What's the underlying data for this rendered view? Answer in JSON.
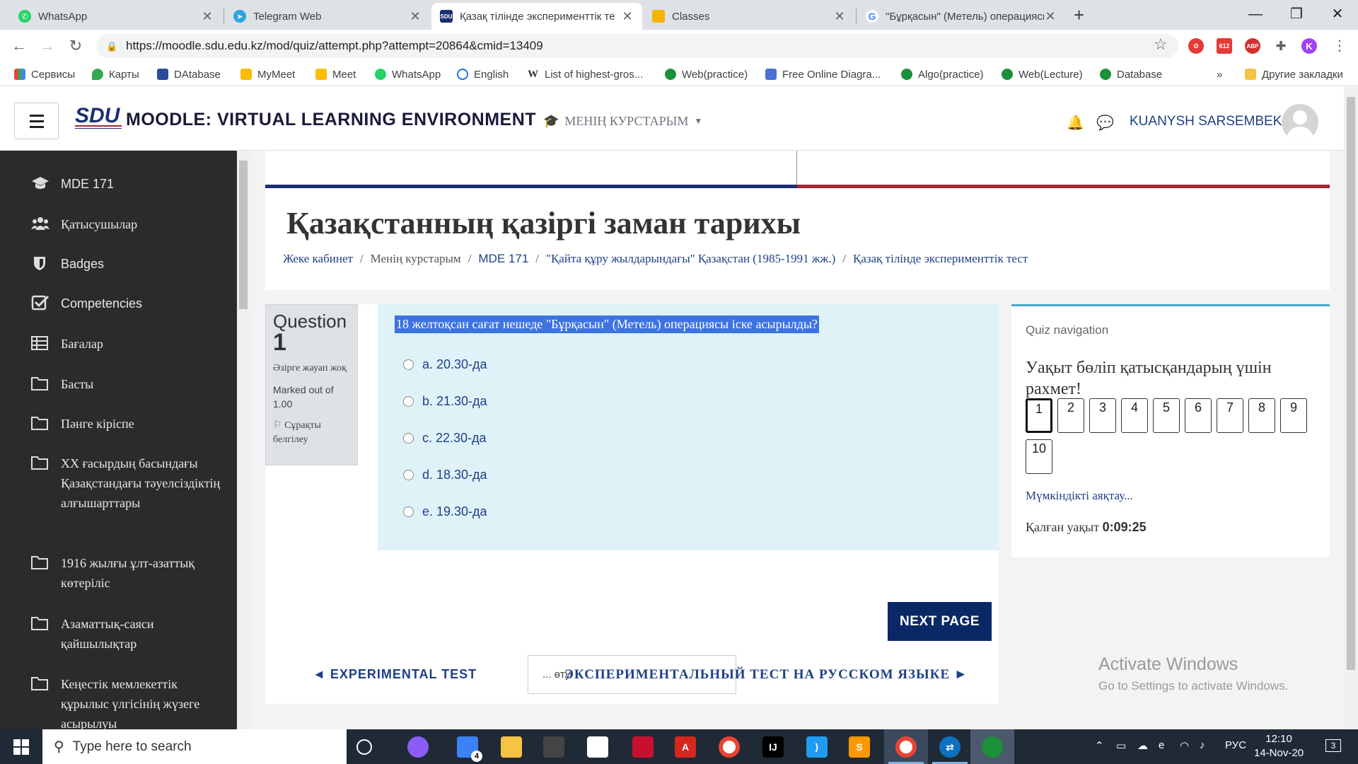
{
  "browser": {
    "tabs": [
      {
        "title": "WhatsApp",
        "color": "#25d366"
      },
      {
        "title": "Telegram Web",
        "color": "#2ca5e0"
      },
      {
        "title": "Қазақ тілінде эксперименттік те",
        "color": "#1c2f73"
      },
      {
        "title": "Classes",
        "color": "#f4b400"
      },
      {
        "title": "\"Бұрқасын\" (Метель) операциясы",
        "color": "#4285f4"
      }
    ],
    "url": "https://moodle.sdu.edu.kz/mod/quiz/attempt.php?attempt=20864&cmid=13409",
    "ext_badge": "612",
    "profile_letter": "K",
    "bookmarks": [
      {
        "label": "Сервисы",
        "color": "#e94235"
      },
      {
        "label": "Карты",
        "color": "#34a853"
      },
      {
        "label": "DAtabase",
        "color": "#2b4a9b"
      },
      {
        "label": "MyMeet",
        "color": "#fbbc04"
      },
      {
        "label": "Meet",
        "color": "#fbbc04"
      },
      {
        "label": "WhatsApp",
        "color": "#25d366"
      },
      {
        "label": "English",
        "color": "#1a73e8"
      },
      {
        "label": "List of highest-gros...",
        "color": "#333333"
      },
      {
        "label": "Web(practice)",
        "color": "#1b8f3a"
      },
      {
        "label": "Free Online Diagra...",
        "color": "#4a6fd6"
      },
      {
        "label": "Algo(practice)",
        "color": "#1b8f3a"
      },
      {
        "label": "Web(Lecture)",
        "color": "#1b8f3a"
      },
      {
        "label": "Database",
        "color": "#1b8f3a"
      }
    ],
    "more": "»",
    "other_bookmarks": "Другие закладки"
  },
  "header": {
    "site_name": "MOODLE: VIRTUAL LEARNING ENVIRONMENT",
    "logo_text": "SDU",
    "my_courses": "МЕНІҢ КУРСТАРЫМ",
    "user_name": "KUANYSH SARSEMBEK"
  },
  "sidebar": {
    "items": [
      {
        "label": "MDE 171",
        "icon": "graduation-cap-icon"
      },
      {
        "label": "Қатысушылар",
        "icon": "users-icon"
      },
      {
        "label": "Badges",
        "icon": "shield-icon"
      },
      {
        "label": "Competencies",
        "icon": "checkbox-icon"
      },
      {
        "label": "Бағалар",
        "icon": "table-icon"
      },
      {
        "label": "Басты",
        "icon": "folder-icon"
      },
      {
        "label": "Пәнге кіріспе",
        "icon": "folder-icon"
      },
      {
        "label": "ХХ ғасырдың басындағы Қазақстандағы тәуелсіздіктің алғышарттары",
        "icon": "folder-icon"
      },
      {
        "label": "1916 жылғы ұлт-азаттық көтеріліс",
        "icon": "folder-icon"
      },
      {
        "label": "Азаматтық-саяси қайшылықтар",
        "icon": "folder-icon"
      },
      {
        "label": "Кеңестік мемлекеттік құрылыс үлгісінің жүзеге асырылуы",
        "icon": "folder-icon"
      }
    ]
  },
  "page": {
    "title": "Қазақстанның қазіргі заман тарихы",
    "breadcrumb": [
      "Жеке кабинет",
      "Менің курстарым",
      "MDE 171",
      "\"Қайта құру жылдарындағы\" Қазақстан (1985-1991 жж.)",
      "Қазақ тілінде эксперименттік тест"
    ]
  },
  "question": {
    "label": "Question",
    "number": "1",
    "status": "Әзірге жауап жоқ",
    "marked": "Marked out of 1.00",
    "flag": "Сұрақты белгілеу",
    "text": "18 желтоқсан сағат нешеде \"Бұрқасын\" (Метель) операциясы іске асырылды?",
    "answers": [
      "a. 20.30-да",
      "b. 21.30-да",
      "c. 22.30-да",
      "d. 18.30-да",
      "e. 19.30-да"
    ]
  },
  "footer_nav": {
    "next_page": "NEXT PAGE",
    "prev_activity": "◄ EXPERIMENTAL TEST",
    "jump_to": "... өту",
    "next_activity": "ЭКСПЕРИМЕНТАЛЬНЫЙ ТЕСТ НА РУССКОМ ЯЗЫКЕ ►"
  },
  "quiz_nav": {
    "heading": "Quiz navigation",
    "thanks": "Уақыт бөліп қатысқандарың үшін рахмет!",
    "buttons": [
      "1",
      "2",
      "3",
      "4",
      "5",
      "6",
      "7",
      "8",
      "9",
      "10"
    ],
    "current": "1",
    "finish": "Мүмкіндікті аяқтау...",
    "time_label": "Қалған уақыт",
    "time_value": "0:09:25"
  },
  "watermark": {
    "line1": "Activate Windows",
    "line2": "Go to Settings to activate Windows."
  },
  "taskbar": {
    "search_placeholder": "Type here to search",
    "mail_badge": "4",
    "language": "РУС",
    "time": "12:10",
    "date": "14-Nov-20",
    "notif_count": "3"
  }
}
